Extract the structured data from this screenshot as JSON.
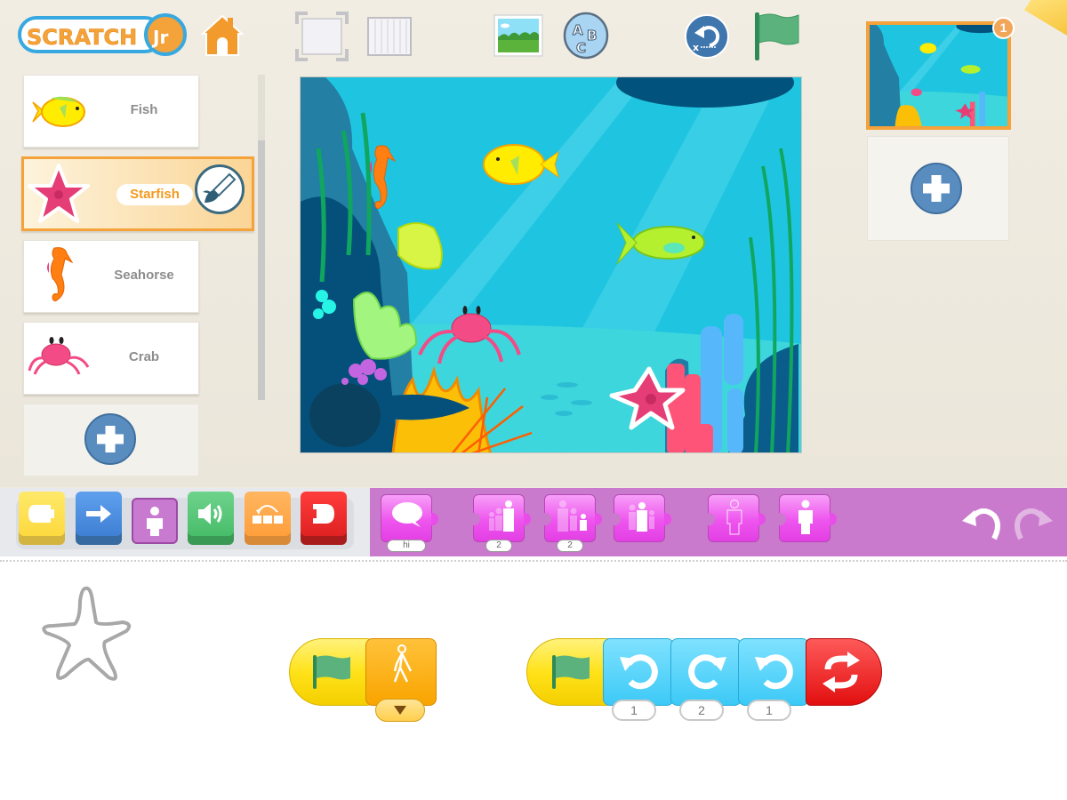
{
  "app": {
    "logo_text": "ScratchJr"
  },
  "toolbar": {
    "icons": [
      "home-icon",
      "full-screen-icon",
      "grid-icon",
      "change-background-icon",
      "add-text-icon",
      "reset-characters-icon",
      "green-flag-icon"
    ]
  },
  "sprites": {
    "items": [
      {
        "name": "Fish",
        "selected": false
      },
      {
        "name": "Starfish",
        "selected": true
      },
      {
        "name": "Seahorse",
        "selected": false
      },
      {
        "name": "Crab",
        "selected": false
      }
    ],
    "add_label": "add-character"
  },
  "pages": {
    "current_page_number": "1"
  },
  "palette": {
    "categories": [
      {
        "id": "triggering",
        "color": "#fcdc48"
      },
      {
        "id": "motion",
        "color": "#4a8ad8"
      },
      {
        "id": "looks",
        "color": "#c87ad0",
        "selected": true
      },
      {
        "id": "sound",
        "color": "#4fc26c"
      },
      {
        "id": "control",
        "color": "#ffa34a"
      },
      {
        "id": "end",
        "color": "#e5282a"
      }
    ],
    "looks_blocks": [
      {
        "id": "say",
        "value": "hi"
      },
      {
        "id": "grow",
        "value": "2"
      },
      {
        "id": "shrink",
        "value": "2"
      },
      {
        "id": "reset-size",
        "value": null
      },
      {
        "id": "hide",
        "value": null
      },
      {
        "id": "show",
        "value": null
      }
    ],
    "accent": "#ca7acc"
  },
  "script": {
    "stacks": [
      {
        "blocks": [
          {
            "type": "start-on-green-flag"
          },
          {
            "type": "walk-animation",
            "dropdown": true
          }
        ]
      },
      {
        "blocks": [
          {
            "type": "start-on-green-flag"
          },
          {
            "type": "turn-left",
            "value": "1"
          },
          {
            "type": "turn-right",
            "value": "2"
          },
          {
            "type": "turn-left",
            "value": "1"
          },
          {
            "type": "repeat-forever"
          }
        ]
      }
    ]
  }
}
